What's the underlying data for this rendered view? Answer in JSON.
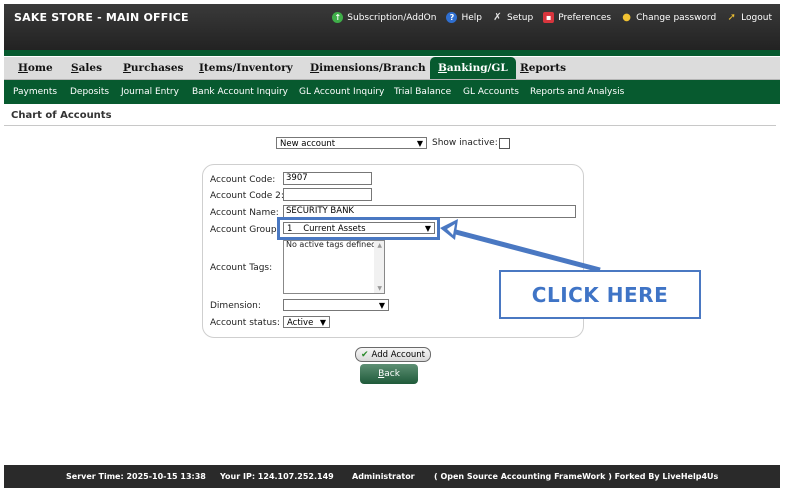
{
  "app": {
    "title": "SAKE STORE - MAIN OFFICE"
  },
  "top_links": [
    {
      "label": "Subscription/AddOn",
      "icon": "addon-icon"
    },
    {
      "label": "Help",
      "icon": "help-icon"
    },
    {
      "label": "Setup",
      "icon": "setup-icon"
    },
    {
      "label": "Preferences",
      "icon": "preferences-icon"
    },
    {
      "label": "Change password",
      "icon": "lock-icon"
    },
    {
      "label": "Logout",
      "icon": "logout-icon"
    }
  ],
  "main_tabs": [
    {
      "first": "H",
      "rest": "ome"
    },
    {
      "first": "S",
      "rest": "ales"
    },
    {
      "first": "P",
      "rest": "urchases"
    },
    {
      "first": "I",
      "rest": "tems/Inventory"
    },
    {
      "first": "D",
      "rest": "imensions/Branch"
    },
    {
      "first": "B",
      "rest": "anking/GL"
    },
    {
      "first": "R",
      "rest": "eports"
    }
  ],
  "sub_tabs": [
    "Payments",
    "Deposits",
    "Journal Entry",
    "Bank Account Inquiry",
    "GL Account Inquiry",
    "Trial Balance",
    "GL Accounts",
    "Reports and Analysis"
  ],
  "page": {
    "title": "Chart of Accounts"
  },
  "selector": {
    "value": "New account",
    "show_inactive_label": "Show inactive:"
  },
  "form": {
    "account_code_label": "Account Code:",
    "account_code_value": "3907",
    "account_code2_label": "Account Code 2:",
    "account_code2_value": "",
    "account_name_label": "Account Name:",
    "account_name_value": "SECURITY BANK",
    "account_group_label": "Account Group:",
    "account_group_value": "1    Current Assets",
    "account_tags_label": "Account Tags:",
    "account_tags_empty": "No active tags defined.",
    "dimension_label": "Dimension:",
    "dimension_value": "",
    "account_status_label": "Account status:",
    "account_status_value": "Active"
  },
  "buttons": {
    "add_account": "Add Account",
    "back_first": "B",
    "back_rest": "ack"
  },
  "callout": {
    "text": "CLICK HERE"
  },
  "footer": {
    "server_time": "Server Time: 2025-10-15 13:38",
    "your_ip": "Your IP: 124.107.252.149",
    "user": "Administrator",
    "credit": "( Open Source Accounting FrameWork ) Forked By LiveHelp4Us"
  },
  "colors": {
    "nav_green": "#075a2f",
    "callout_blue": "#4a78c2",
    "topbar": "#2d2d2d"
  }
}
